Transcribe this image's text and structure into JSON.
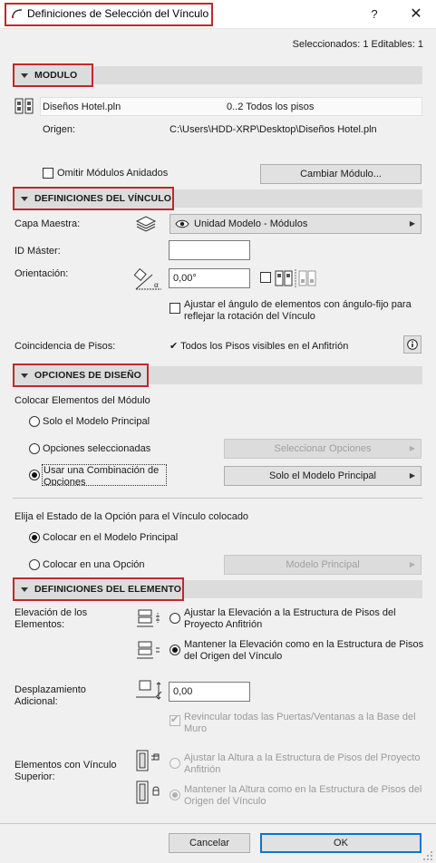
{
  "window": {
    "title": "Definiciones de Selección del Vínculo",
    "help_label": "?",
    "close_label": "✕"
  },
  "selection_info": "Seleccionados: 1 Editables: 1",
  "module_section": {
    "title": "MODULO",
    "file_name": "Diseños Hotel.pln",
    "floors": "0..2 Todos los pisos",
    "origin_label": "Origen:",
    "origin_path": "C:\\Users\\HDD-XRP\\Desktop\\Diseños Hotel.pln",
    "omit_nested_label": "Omitir Módulos Anidados",
    "omit_nested_checked": false,
    "change_module_button": "Cambiar Módulo..."
  },
  "link_section": {
    "title": "DEFINICIONES DEL VÍNCULO",
    "master_layer_label": "Capa Maestra:",
    "master_layer_value": "Unidad Modelo - Módulos",
    "master_id_label": "ID Máster:",
    "master_id_value": "",
    "orientation_label": "Orientación:",
    "orientation_value": "0,00°",
    "mirror_checked": false,
    "adjust_angle_label": "Ajustar el ángulo de elementos con ángulo-fijo para reflejar la rotación del Vínculo",
    "adjust_angle_checked": false,
    "floor_match_label": "Coincidencia de Pisos:",
    "floor_match_value": "✔ Todos los Pisos visibles en el Anfitrión",
    "info_icon": "info-icon"
  },
  "design_section": {
    "title": "OPCIONES DE DISEÑO",
    "place_label": "Colocar Elementos del Módulo",
    "radio_main_model": "Solo el Modelo Principal",
    "radio_selected_options": "Opciones seleccionadas",
    "select_options_button": "Seleccionar Opciones",
    "radio_use_combination": "Usar una Combinación de Opciones",
    "combination_value": "Solo el Modelo Principal",
    "selected_radio": "use_combination",
    "state_label": "Elija el Estado de la Opción para el Vínculo colocado",
    "radio_place_main": "Colocar en el Modelo Principal",
    "radio_place_option": "Colocar en una Opción",
    "option_value": "Modelo Principal",
    "selected_state": "place_main"
  },
  "element_section": {
    "title": "DEFINICIONES DEL ELEMENTO",
    "elevation_label": "Elevación de los Elementos:",
    "radio_adjust_elevation": "Ajustar la Elevación a la Estructura de Pisos del Proyecto Anfitrión",
    "radio_keep_elevation": "Mantener la Elevación como en la Estructura de Pisos del Origen del Vínculo",
    "selected_elevation": "keep",
    "offset_label": "Desplazamiento Adicional:",
    "offset_value": "0,00",
    "relink_label": "Revincular todas las Puertas/Ventanas a la Base del Muro",
    "relink_checked": true,
    "top_linked_label": "Elementos con Vínculo Superior:",
    "radio_adjust_height": "Ajustar la Altura a la Estructura de Pisos del Proyecto Anfitrión",
    "radio_keep_height": "Mantener la Altura como en la Estructura de Pisos del Origen del Vínculo",
    "selected_height": "keep"
  },
  "footer": {
    "cancel_button": "Cancelar",
    "ok_button": "OK"
  },
  "colors": {
    "highlight": "#c0282e",
    "accent_blue": "#0078d7",
    "background": "#f0f0f0"
  }
}
